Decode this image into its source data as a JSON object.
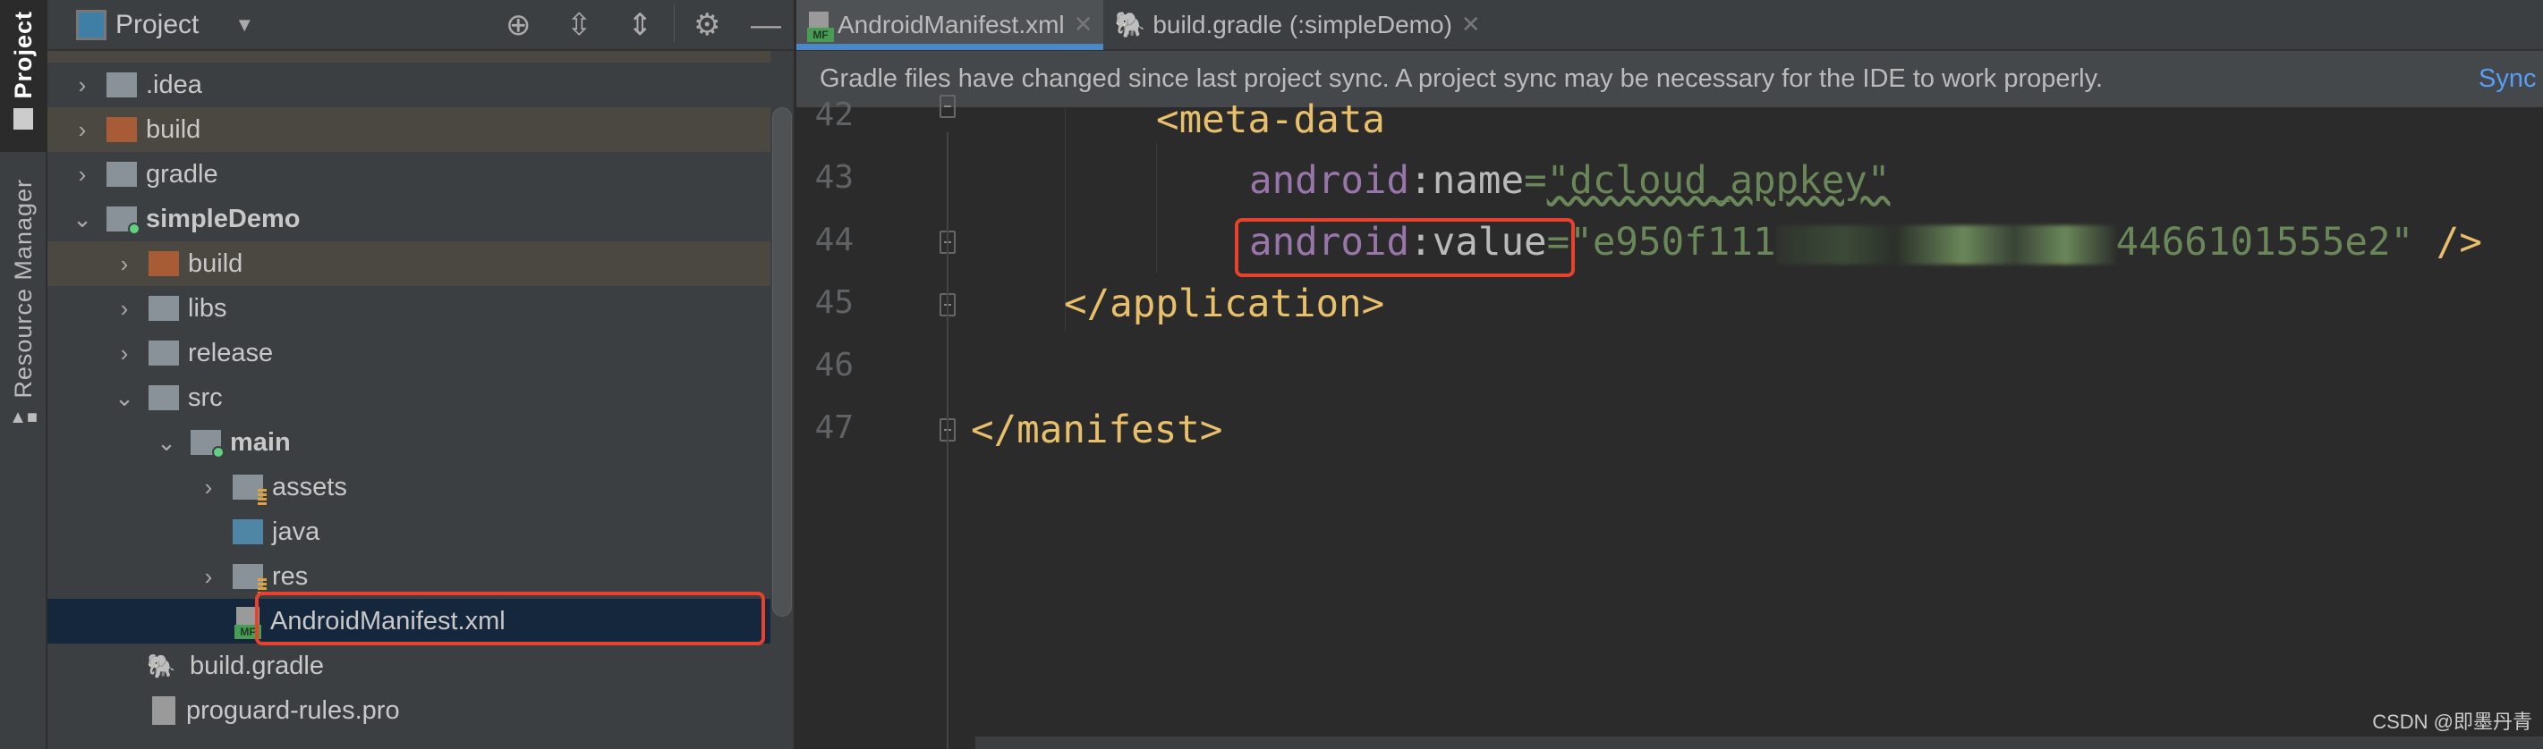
{
  "side_strip": {
    "project_tab": "Project",
    "resource_tab": "Resource Manager"
  },
  "project_panel": {
    "title": "Project",
    "tree": [
      {
        "label": ".idea",
        "level": 1,
        "chevron": "right",
        "icon": "folder-gray"
      },
      {
        "label": "build",
        "level": 1,
        "chevron": "right",
        "icon": "folder-orange",
        "excluded": true
      },
      {
        "label": "gradle",
        "level": 1,
        "chevron": "right",
        "icon": "folder-gray"
      },
      {
        "label": "simpleDemo",
        "level": 1,
        "chevron": "down",
        "icon": "module-folder",
        "bold": true
      },
      {
        "label": "build",
        "level": 2,
        "chevron": "right",
        "icon": "folder-orange",
        "excluded": true
      },
      {
        "label": "libs",
        "level": 2,
        "chevron": "right",
        "icon": "folder-gray"
      },
      {
        "label": "release",
        "level": 2,
        "chevron": "right",
        "icon": "folder-gray"
      },
      {
        "label": "src",
        "level": 2,
        "chevron": "down",
        "icon": "folder-gray"
      },
      {
        "label": "main",
        "level": 3,
        "chevron": "down",
        "icon": "module-folder",
        "bold": true
      },
      {
        "label": "assets",
        "level": 4,
        "chevron": "right",
        "icon": "resource-folder"
      },
      {
        "label": "java",
        "level": 4,
        "chevron": "none",
        "icon": "folder-blue"
      },
      {
        "label": "res",
        "level": 4,
        "chevron": "right",
        "icon": "resource-folder"
      },
      {
        "label": "AndroidManifest.xml",
        "level": 4,
        "chevron": "none",
        "icon": "manifest-file",
        "selected": true
      },
      {
        "label": "build.gradle",
        "level": 2,
        "chevron": "none",
        "icon": "gradle-file"
      },
      {
        "label": "proguard-rules.pro",
        "level": 2,
        "chevron": "none",
        "icon": "text-file"
      }
    ]
  },
  "editor": {
    "tabs": [
      {
        "label": "AndroidManifest.xml",
        "active": true
      },
      {
        "label": "build.gradle (:simpleDemo)",
        "active": false
      }
    ],
    "banner": {
      "message": "Gradle files have changed since last project sync. A project sync may be necessary for the IDE to work properly.",
      "action": "Sync"
    },
    "line_numbers": [
      "42",
      "43",
      "44",
      "45",
      "46",
      "47"
    ],
    "code": {
      "l42_tag": "<meta-data",
      "l43_ns": "android",
      "l43_attr": ":name",
      "l43_eq": "=",
      "l43_val": "\"dcloud_appkey\"",
      "l44_ns": "android",
      "l44_attr": ":value",
      "l44_eq": "=",
      "l44_val_start": "\"e950f111",
      "l44_val_end": "4466101555e2\"",
      "l44_close": " />",
      "l45_tag": "</application>",
      "l47_tag": "</manifest>"
    }
  },
  "watermark": "CSDN @即墨丹青",
  "colors": {
    "highlight_box": "#e8412c",
    "selection": "#14273d",
    "accent": "#4a88c7"
  }
}
